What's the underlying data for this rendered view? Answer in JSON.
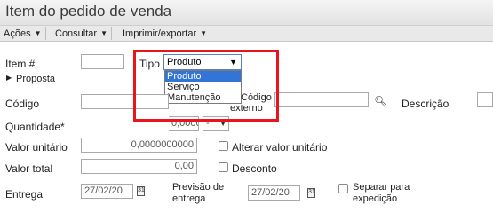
{
  "window": {
    "title": "Item do pedido de venda"
  },
  "toolbar": {
    "menus": [
      {
        "label": "Ações"
      },
      {
        "label": "Consultar"
      },
      {
        "label": "Imprimir/exportar"
      }
    ]
  },
  "form": {
    "item_label": "Item #",
    "item_value": "",
    "tipo_label": "Tipo",
    "tipo_selected": "Produto",
    "tipo_options": [
      "Produto",
      "Serviço",
      "Manutenção"
    ],
    "proposta_label": "Proposta",
    "codigo_label": "Código",
    "codigo_externo_label_1": "Código",
    "codigo_externo_label_2": "externo",
    "descricao_label": "Descrição",
    "quantidade_label": "Quantidade*",
    "quantidade_value": "0,0000",
    "unidade_value": "-",
    "valor_unitario_label": "Valor unitário",
    "valor_unitario_value": "0,0000000000",
    "alterar_valor_label": "Alterar valor unitário",
    "valor_total_label": "Valor total",
    "valor_total_value": "0,00",
    "desconto_label": "Desconto",
    "entrega_label": "Entrega",
    "entrega_value": "27/02/20",
    "previsao_label_1": "Previsão de",
    "previsao_label_2": "entrega",
    "previsao_value": "27/02/20",
    "separar_label_1": "Separar para",
    "separar_label_2": "expedição"
  },
  "colors": {
    "highlight": "#e8151b",
    "selected_option": "#3375d6"
  }
}
